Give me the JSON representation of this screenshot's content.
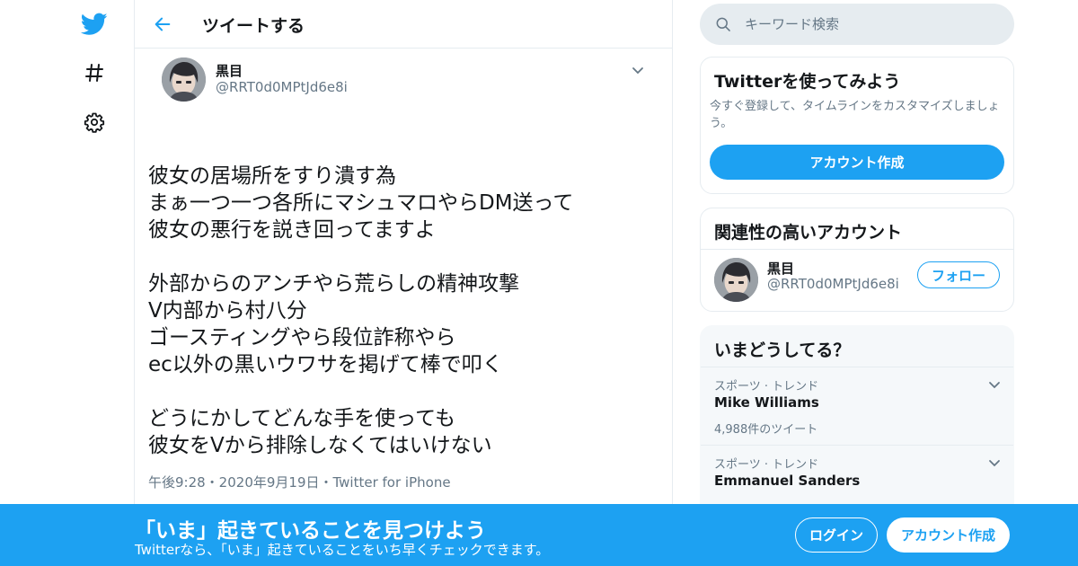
{
  "colors": {
    "accent": "#1da1f2",
    "text": "#14171a",
    "muted": "#657786",
    "border": "#e6ecf0"
  },
  "nav": {
    "icons": [
      "twitter-bird-icon",
      "hashtag-icon",
      "gear-icon"
    ]
  },
  "header": {
    "title": "ツイートする"
  },
  "tweet": {
    "author_name": "黒目",
    "author_handle": "@RRT0d0MPtJd6e8i",
    "lines": [
      "彼女の居場所をすり潰す為",
      "まぁ一つ一つ各所にマシュマロやらDM送って",
      "彼女の悪行を説き回ってますよ",
      "",
      "外部からのアンチやら荒らしの精神攻撃",
      "V内部から村八分",
      "ゴースティングやら段位詐称やら",
      "ec以外の黒いウワサを掲げて棒で叩く",
      "",
      "どうにかしてどんな手を使っても",
      "彼女をVから排除しなくてはいけない"
    ],
    "meta": "午後9:28・2020年9月19日・Twitter for iPhone"
  },
  "search": {
    "placeholder": "キーワード検索"
  },
  "signup_card": {
    "title": "Twitterを使ってみよう",
    "description": "今すぐ登録して、タイムラインをカスタマイズしましょう。",
    "button": "アカウント作成"
  },
  "related_card": {
    "title": "関連性の高いアカウント",
    "name": "黒目",
    "handle": "@RRT0d0MPtJd6e8i",
    "follow_label": "フォロー"
  },
  "trends_card": {
    "title": "いまどうしてる？",
    "items": [
      {
        "category": "スポーツ · トレンド",
        "name": "Mike Williams",
        "count": "4,988件のツイート"
      },
      {
        "category": "スポーツ · トレンド",
        "name": "Emmanuel Sanders",
        "count": ""
      }
    ]
  },
  "banner": {
    "title": "「いま」起きていることを見つけよう",
    "subtitle": "Twitterなら、「いま」起きていることをいち早くチェックできます。",
    "login_label": "ログイン",
    "signup_label": "アカウント作成"
  }
}
